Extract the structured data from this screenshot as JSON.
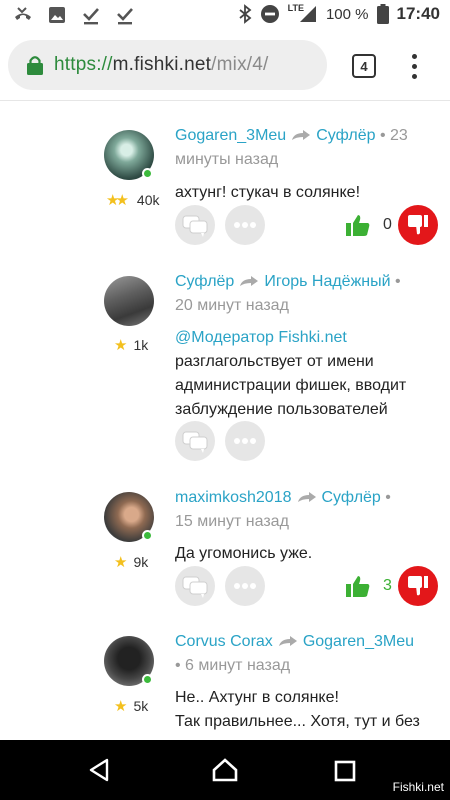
{
  "status_bar": {
    "network": "LTE",
    "battery": "100 %",
    "time": "17:40"
  },
  "browser": {
    "url_scheme": "https://",
    "url_host": "m.fishki.net",
    "url_path": "/mix/4/",
    "tab_count": "4"
  },
  "comments": [
    {
      "author": "Gogaren_3Meu",
      "reply_to": "Суфлёр",
      "time_line1": " • 23",
      "time_line2": "минуты назад",
      "rating": "40k",
      "stars": 2,
      "text_lines": [
        "ахтунг! стукач в солянке!"
      ],
      "likes": "0"
    },
    {
      "author": "Суфлёр",
      "reply_to": "Игорь Надёжный",
      "time_line1": " •",
      "time_line2": "20 минут назад",
      "rating": "1k",
      "stars": 1,
      "mention": "@Модератор Fishki.net",
      "text_lines": [
        "разглагольствует от имени",
        "администрации фишек, вводит",
        "заблуждение пользователей"
      ]
    },
    {
      "author": "maximkosh2018",
      "reply_to": "Суфлёр",
      "time_line1": " •",
      "time_line2": "15 минут назад",
      "rating": "9k",
      "stars": 1,
      "text_lines": [
        "Да угомонись уже."
      ],
      "likes": "3"
    },
    {
      "author": "Corvus Corax",
      "reply_to": "Gogaren_3Meu",
      "time_line1": "",
      "time_line2": "• 6 минут назад",
      "rating": "5k",
      "stars": 1,
      "text_lines": [
        "Не.. Ахтунг в солянке!",
        "Так правильнее... Хотя, тут и без"
      ]
    }
  ],
  "watermark": "Fishki.net",
  "colors": {
    "link": "#2aa3c6",
    "like": "#3cb034",
    "dislike": "#e3171a",
    "online": "#3cba3c",
    "url_scheme": "#2e8b3d"
  }
}
